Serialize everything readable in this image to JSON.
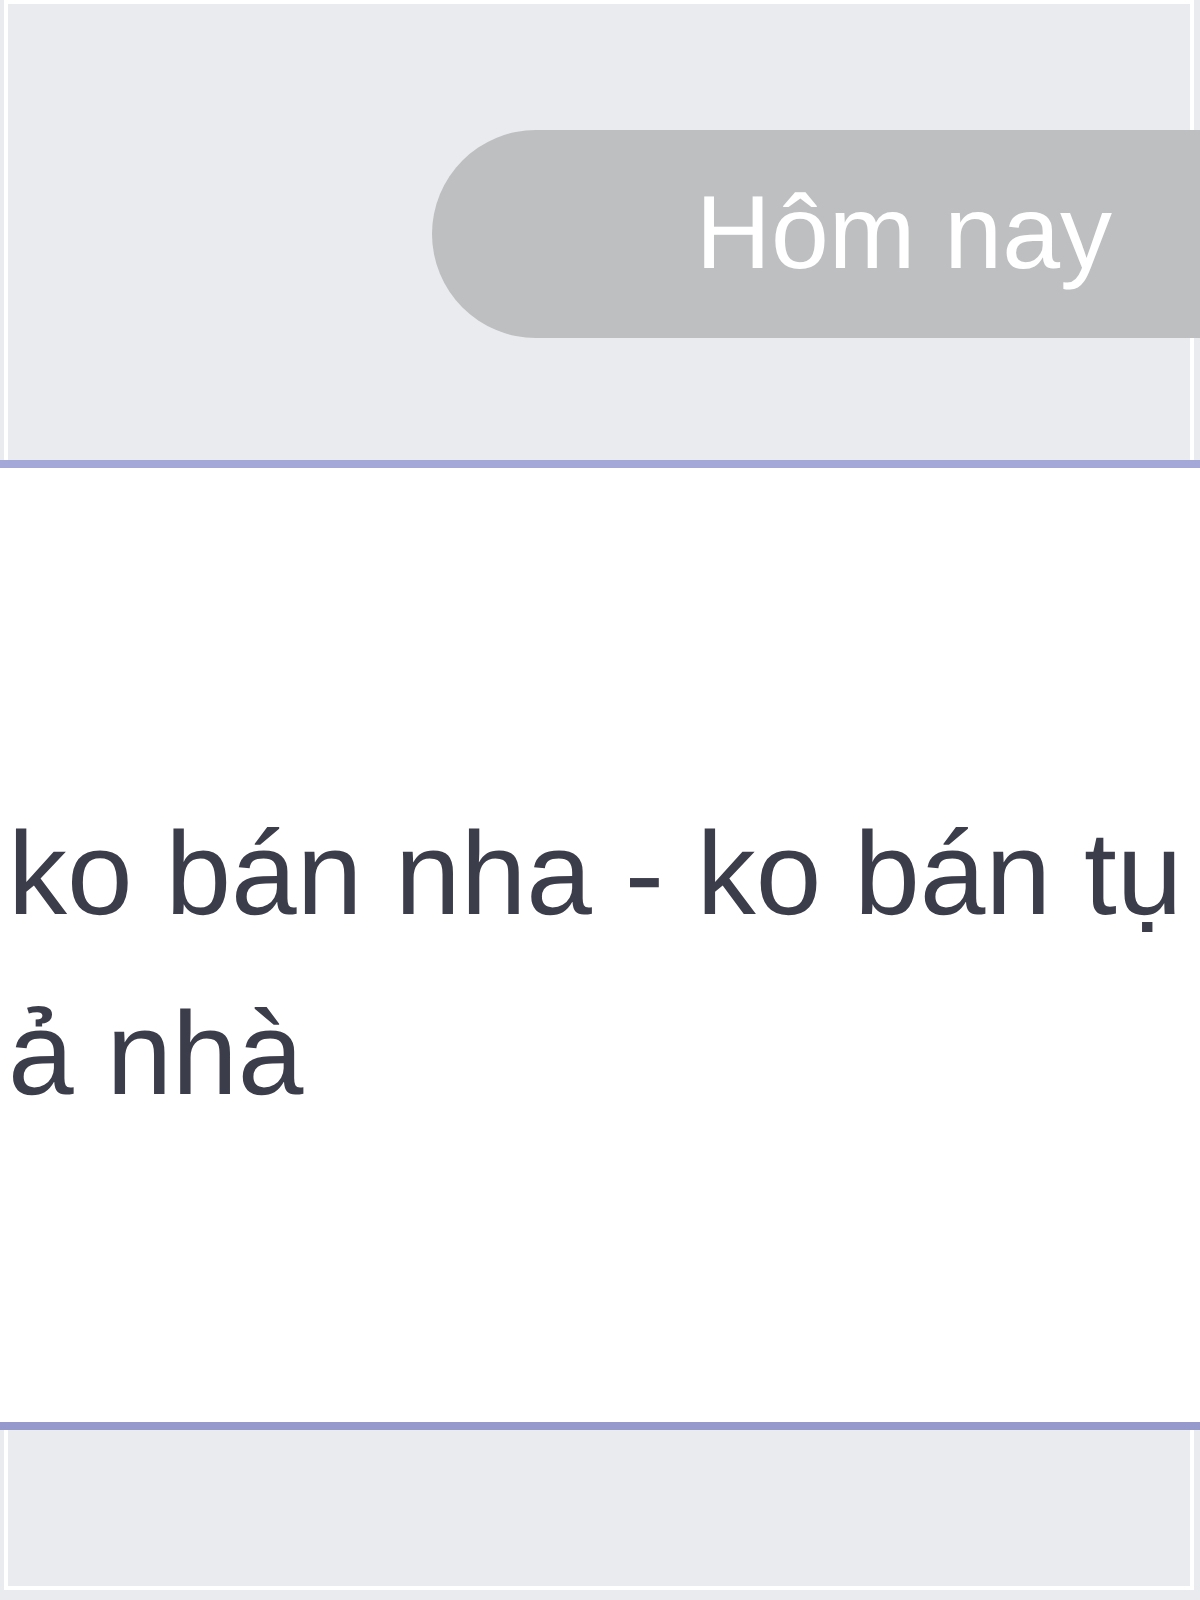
{
  "date_divider": {
    "label": "Hôm nay"
  },
  "message": {
    "lines": [
      "ko bán nha - ko bán tụ",
      "ả nhà"
    ]
  }
}
